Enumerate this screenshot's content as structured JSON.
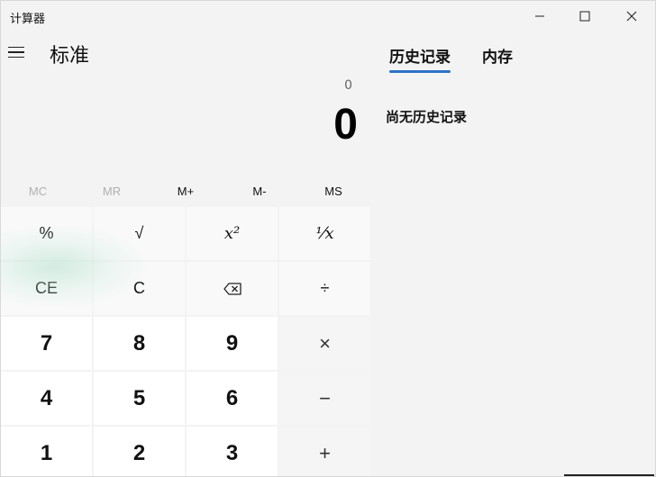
{
  "window": {
    "title": "计算器"
  },
  "header": {
    "mode_title": "标准"
  },
  "display": {
    "expression": "0",
    "result": "0"
  },
  "memory": {
    "buttons": [
      {
        "label": "MC",
        "enabled": false
      },
      {
        "label": "MR",
        "enabled": false
      },
      {
        "label": "M+",
        "enabled": true
      },
      {
        "label": "M-",
        "enabled": true
      },
      {
        "label": "MS",
        "enabled": true
      }
    ]
  },
  "keypad": {
    "row1": {
      "percent": "%",
      "sqrt": "√",
      "square": "x²",
      "reciprocal": "⅟x"
    },
    "row2": {
      "ce": "CE",
      "c": "C",
      "divide": "÷"
    },
    "row3": {
      "seven": "7",
      "eight": "8",
      "nine": "9",
      "multiply": "×"
    },
    "row4": {
      "four": "4",
      "five": "5",
      "six": "6",
      "minus": "−"
    },
    "row5": {
      "one": "1",
      "two": "2",
      "three": "3",
      "plus": "+"
    }
  },
  "panel": {
    "tabs": {
      "history": "历史记录",
      "memory": "内存"
    },
    "active_tab": "history",
    "empty_message": "尚无历史记录"
  },
  "colors": {
    "accent": "#2b73c9",
    "background": "#f3f3f3",
    "number_key": "#ffffff"
  },
  "icons": {
    "menu": "hamburger-icon",
    "backspace": "backspace-icon",
    "minimize": "minimize-icon",
    "maximize": "maximize-icon",
    "close": "close-icon"
  }
}
